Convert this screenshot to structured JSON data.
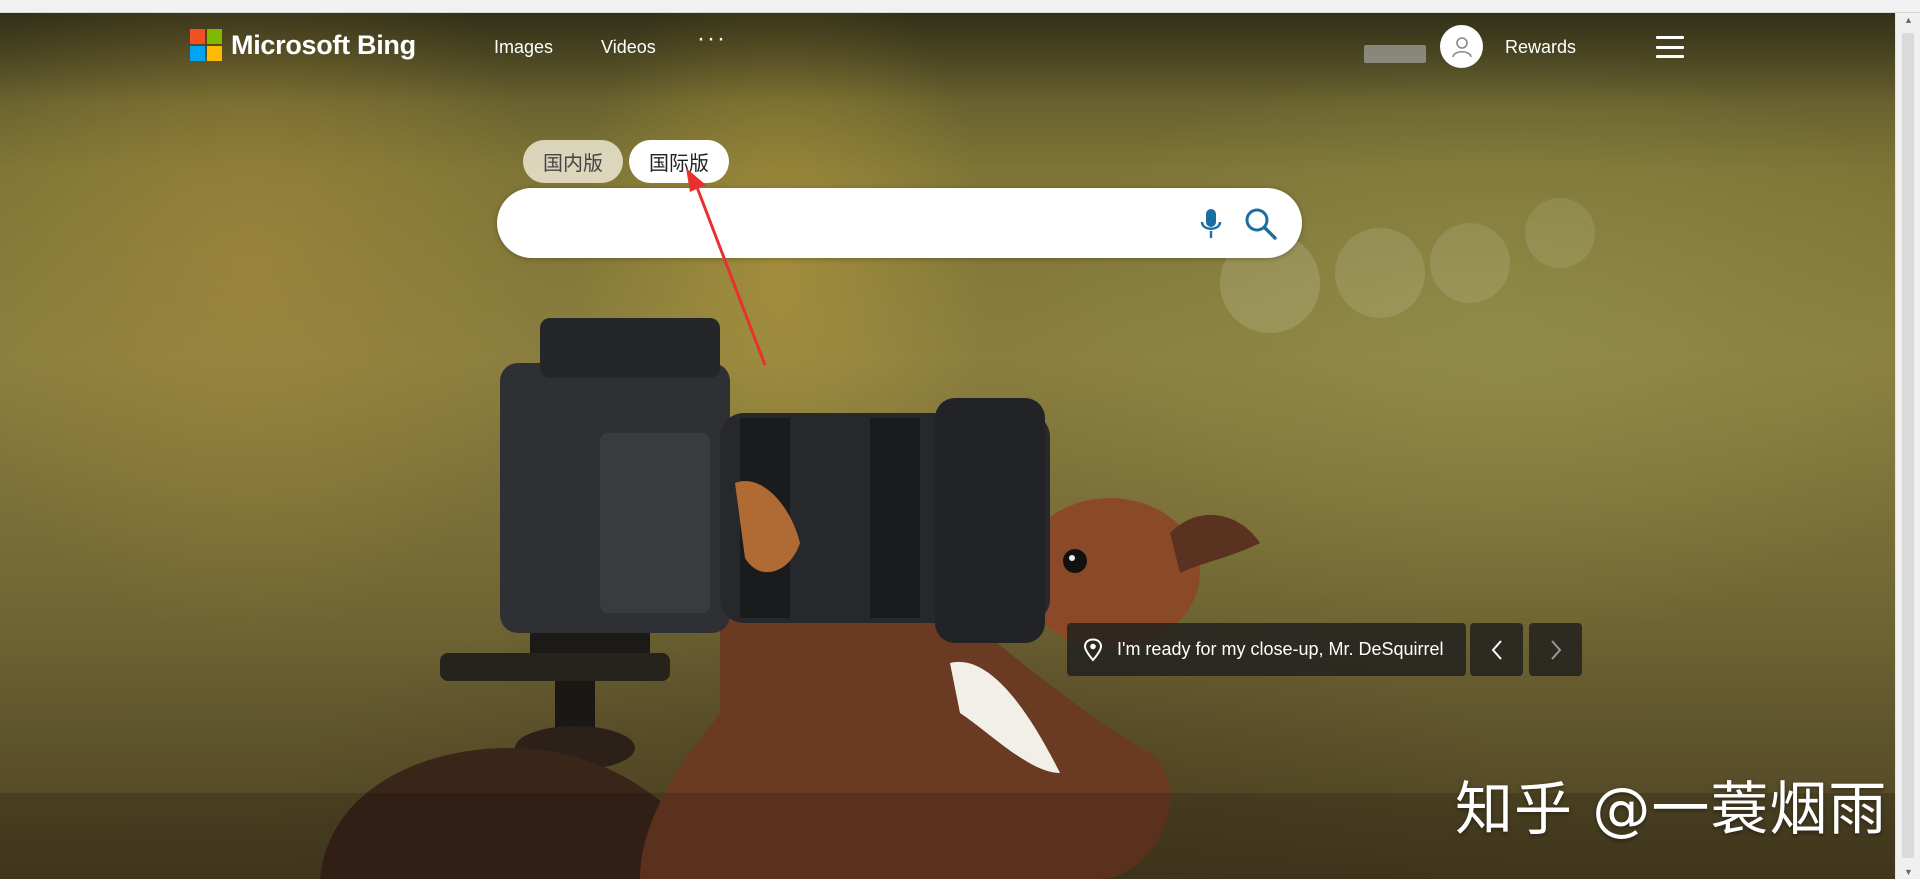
{
  "header": {
    "logo_text": "Microsoft Bing",
    "nav_links": [
      "Images",
      "Videos"
    ],
    "more_label": "···",
    "rewards_label": "Rewards"
  },
  "tabs": {
    "domestic_label": "国内版",
    "international_label": "国际版",
    "active": "国际版"
  },
  "search": {
    "value": "",
    "placeholder": ""
  },
  "image_caption": {
    "text": "I'm ready for my close-up, Mr. DeSquirrel"
  },
  "watermark": {
    "text": "知乎 @一蓑烟雨"
  },
  "icons": {
    "logo": "microsoft-logo-icon",
    "profile": "user-icon",
    "menu": "hamburger-icon",
    "mic": "microphone-icon",
    "search": "search-icon",
    "location": "location-pin-icon",
    "prev": "chevron-left-icon",
    "next": "chevron-right-icon"
  },
  "colors": {
    "ms_red": "#f25022",
    "ms_green": "#7fba00",
    "ms_blue": "#00a4ef",
    "ms_yellow": "#ffb900",
    "search_icon": "#1a6fa0",
    "annotation_arrow": "#e8312f"
  }
}
